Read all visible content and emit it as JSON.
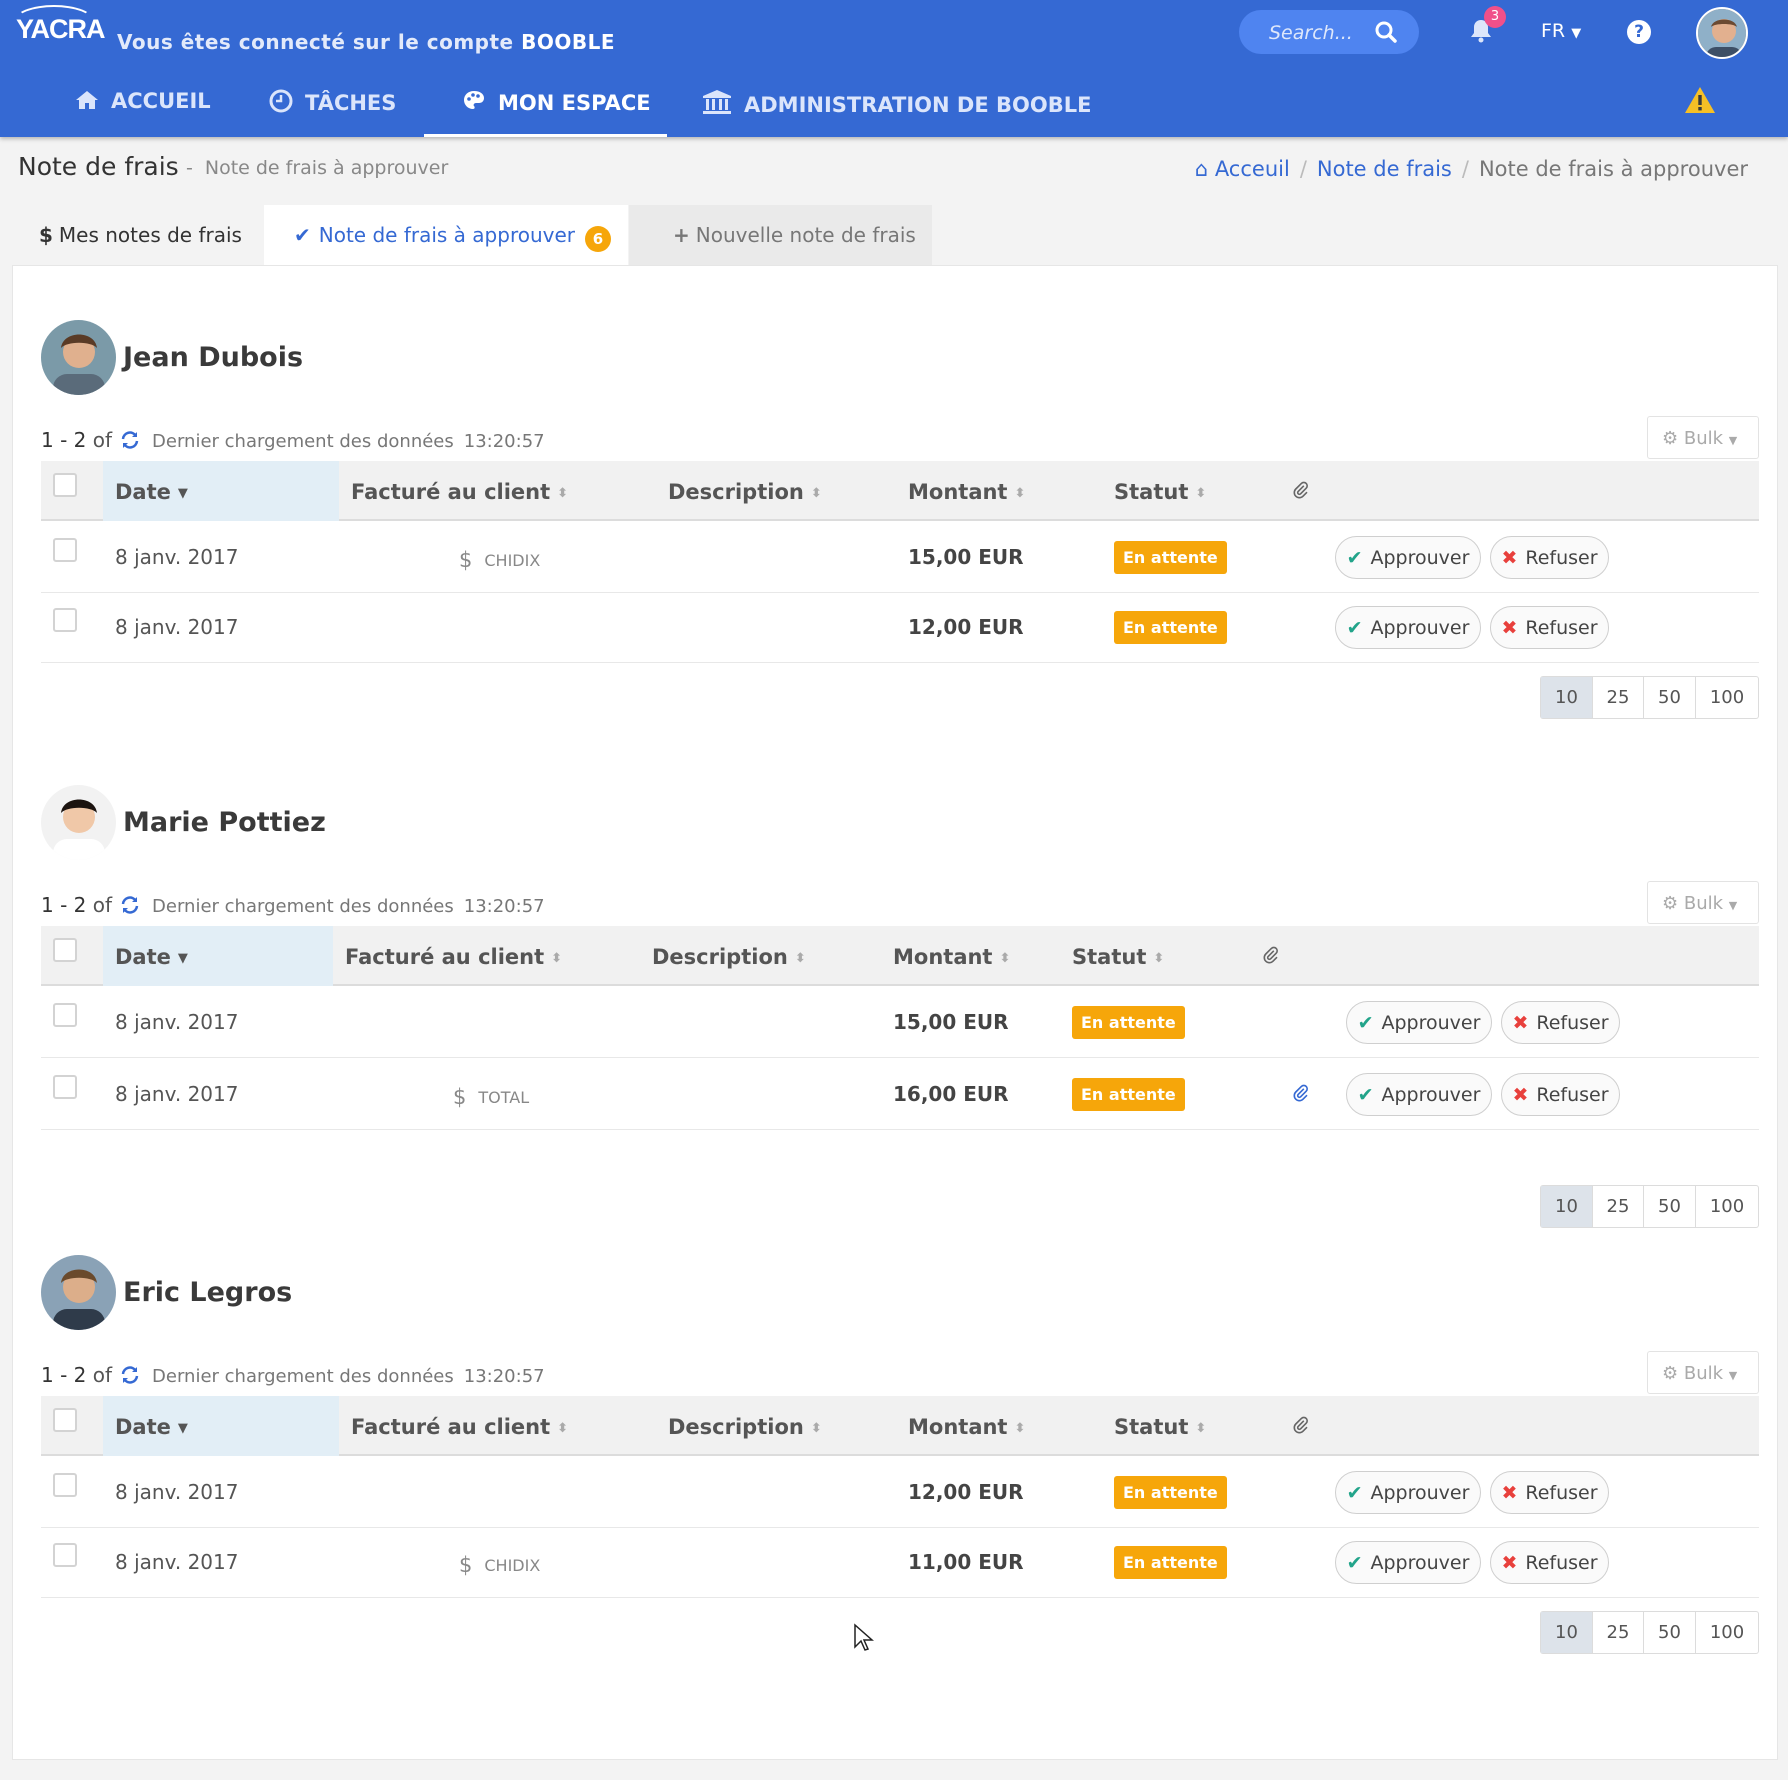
{
  "app": {
    "logo": "YACRA",
    "connected_prefix": "Vous êtes connecté sur le compte",
    "account": "BOOBLE"
  },
  "header": {
    "search_placeholder": "Search...",
    "notifications_count": "3",
    "language": "FR"
  },
  "nav": [
    {
      "label": "ACCUEIL",
      "icon": "home-icon"
    },
    {
      "label": "TÂCHES",
      "icon": "clock-icon"
    },
    {
      "label": "MON ESPACE",
      "icon": "palette-icon",
      "active": true
    },
    {
      "label": "ADMINISTRATION DE BOOBLE",
      "icon": "bank-icon"
    }
  ],
  "page": {
    "title": "Note de frais",
    "subtitle": "Note de frais à approuver"
  },
  "breadcrumb": {
    "home": "Acceuil",
    "section": "Note de frais",
    "current": "Note de frais à approuver"
  },
  "tabs": {
    "mine": "Mes notes de frais",
    "to_approve": "Note de frais à approuver",
    "to_approve_count": "6",
    "new": "Nouvelle note de frais"
  },
  "labels": {
    "range": "1 - 2",
    "of": "of",
    "loaded": "Dernier chargement des données",
    "bulk": "Bulk",
    "col_date": "Date",
    "col_client": "Facturé au client",
    "col_description": "Description",
    "col_amount": "Montant",
    "col_status": "Statut",
    "approve": "Approuver",
    "refuse": "Refuser",
    "page_sizes": [
      "10",
      "25",
      "50",
      "100"
    ]
  },
  "users": [
    {
      "name": "Jean Dubois",
      "time": "13:20:57",
      "rows": [
        {
          "date": "8 janv. 2017",
          "client": "CHIDIX",
          "amount": "15,00 EUR",
          "status": "En attente",
          "attachment": false
        },
        {
          "date": "8 janv. 2017",
          "client": "",
          "amount": "12,00 EUR",
          "status": "En attente",
          "attachment": false
        }
      ]
    },
    {
      "name": "Marie Pottiez",
      "time": "13:20:57",
      "rows": [
        {
          "date": "8 janv. 2017",
          "client": "",
          "amount": "15,00 EUR",
          "status": "En attente",
          "attachment": false
        },
        {
          "date": "8 janv. 2017",
          "client": "TOTAL",
          "amount": "16,00 EUR",
          "status": "En attente",
          "attachment": true
        }
      ]
    },
    {
      "name": "Eric Legros",
      "time": "13:20:57",
      "rows": [
        {
          "date": "8 janv. 2017",
          "client": "",
          "amount": "12,00 EUR",
          "status": "En attente",
          "attachment": false
        },
        {
          "date": "8 janv. 2017",
          "client": "CHIDIX",
          "amount": "11,00 EUR",
          "status": "En attente",
          "attachment": false
        }
      ]
    }
  ]
}
